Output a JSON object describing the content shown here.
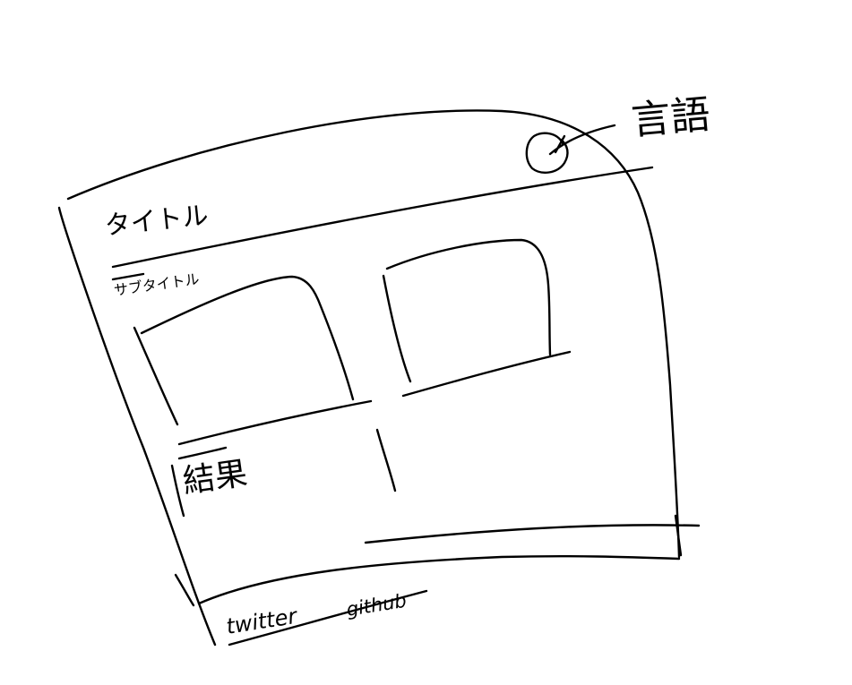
{
  "header": {
    "title": "タイトル",
    "language_label": "言語",
    "language_icon": "language-circle-icon"
  },
  "main": {
    "subtitle": "サブタイトル",
    "result_label": "結果"
  },
  "footer": {
    "twitter_label": "twitter",
    "github_label": "github"
  },
  "colors": {
    "stroke": "#000000",
    "background": "#ffffff"
  }
}
